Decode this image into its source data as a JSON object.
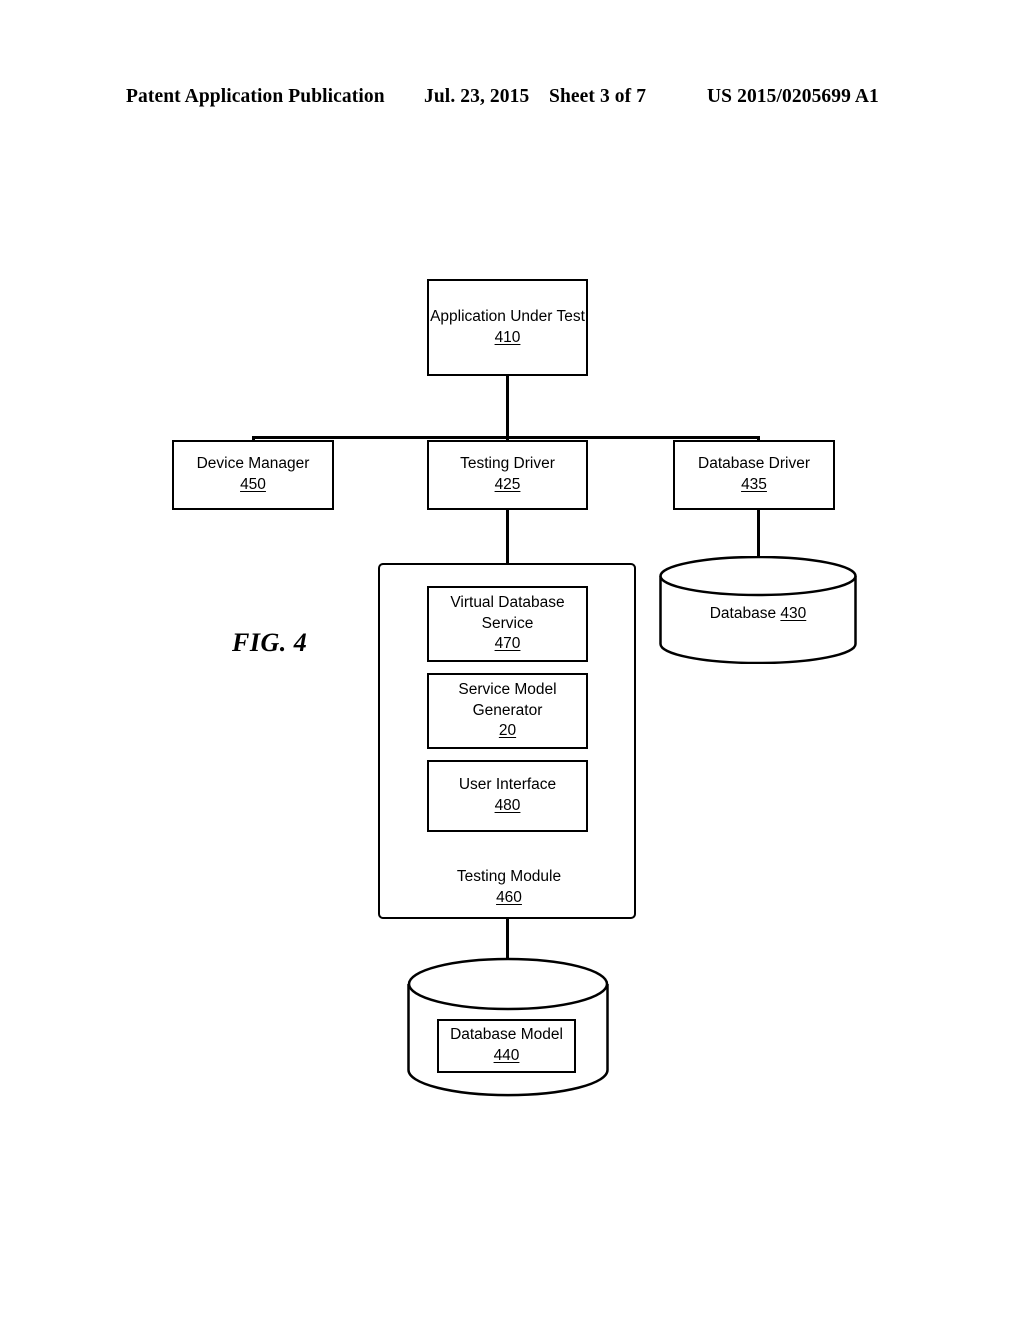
{
  "header": {
    "publication": "Patent Application Publication",
    "date": "Jul. 23, 2015",
    "sheet": "Sheet 3 of 7",
    "number": "US 2015/0205699 A1"
  },
  "figure": {
    "label": "FIG. 4"
  },
  "diagram": {
    "application_under_test": {
      "title": "Application Under Test",
      "ref": "410"
    },
    "device_manager": {
      "title": "Device Manager",
      "ref": "450"
    },
    "testing_driver": {
      "title": "Testing Driver",
      "ref": "425"
    },
    "database_driver": {
      "title": "Database Driver",
      "ref": "435"
    },
    "database": {
      "title": "Database",
      "ref": "430"
    },
    "testing_module": {
      "title": "Testing Module",
      "ref": "460"
    },
    "virtual_database_service": {
      "line1": "Virtual Database",
      "line2": "Service",
      "ref": "470"
    },
    "service_model_generator": {
      "line1": "Service Model",
      "line2": "Generator",
      "ref": "20"
    },
    "user_interface": {
      "title": "User Interface",
      "ref": "480"
    },
    "database_model": {
      "title": "Database Model",
      "ref": "440"
    }
  },
  "colors": {
    "ink": "#000000",
    "page": "#ffffff"
  }
}
